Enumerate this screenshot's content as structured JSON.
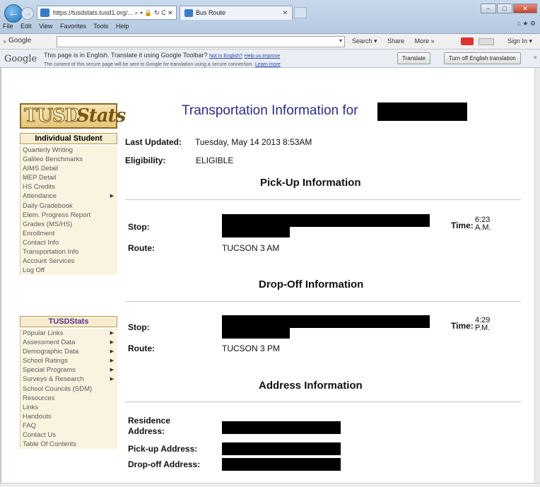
{
  "browser": {
    "address": "https://tusdstats.tusd1.org/...",
    "address_controls": "⌕ ▾ 🔒 ↻ C ✕",
    "tab_title": "Bus Route",
    "menu": [
      "File",
      "Edit",
      "View",
      "Favorites",
      "Tools",
      "Help"
    ],
    "google_label": "Google",
    "google_items": [
      "Search ▾",
      "Share",
      "More »"
    ],
    "signin": "Sign In ▾"
  },
  "translate": {
    "logo": "Google",
    "message": "This page is in English.  Translate it using Google Toolbar?",
    "not_english": "Not in English?",
    "help": "Help us improve",
    "subtext": "The content of this secure page will be sent to Google for translation using a secure connection.",
    "learn_more": "Learn more",
    "translate_button": "Translate",
    "turn_off_button": "Turn off English translation"
  },
  "logo": {
    "part1": "TUSD",
    "part2": "Stats"
  },
  "sidebar": {
    "section1_title": "Individual Student",
    "section1_items": [
      {
        "label": "Quarterly Writing",
        "arrow": false
      },
      {
        "label": "Galileo Benchmarks",
        "arrow": false
      },
      {
        "label": "AIMS Detail",
        "arrow": false
      },
      {
        "label": "MEP Detail",
        "arrow": false
      },
      {
        "label": "HS Credits",
        "arrow": false
      },
      {
        "label": "Attendance",
        "arrow": true
      },
      {
        "label": "Daily Gradebook",
        "arrow": false
      },
      {
        "label": "Elem. Progress Report",
        "arrow": false
      },
      {
        "label": "Grades (MS/HS)",
        "arrow": false
      },
      {
        "label": "Enrollment",
        "arrow": false
      },
      {
        "label": "Contact Info",
        "arrow": false
      },
      {
        "label": "Transportation Info",
        "arrow": false
      },
      {
        "label": "Account Services",
        "arrow": false
      },
      {
        "label": "Log Off",
        "arrow": false
      }
    ],
    "section2_title": "TUSDStats",
    "section2_items": [
      {
        "label": "Popular Links",
        "arrow": true
      },
      {
        "label": "Assessment Data",
        "arrow": true
      },
      {
        "label": "Demographic Data",
        "arrow": true
      },
      {
        "label": "School Ratings",
        "arrow": true
      },
      {
        "label": "Special Programs",
        "arrow": true
      },
      {
        "label": "Surveys & Research",
        "arrow": true
      },
      {
        "label": "School Councils (SDM)",
        "arrow": false
      },
      {
        "label": "Resources",
        "arrow": false
      },
      {
        "label": "Links",
        "arrow": false
      },
      {
        "label": "Handouts",
        "arrow": false
      },
      {
        "label": "FAQ",
        "arrow": false
      },
      {
        "label": "Contact Us",
        "arrow": false
      },
      {
        "label": "Table Of Contents",
        "arrow": false
      }
    ]
  },
  "main": {
    "title": "Transportation Information for",
    "last_updated_label": "Last Updated:",
    "last_updated_value": "Tuesday, May 14 2013 8:53AM",
    "eligibility_label": "Eligibility:",
    "eligibility_value": "ELIGIBLE",
    "pickup": {
      "heading": "Pick-Up Information",
      "stop_label": "Stop:",
      "time_label": "Time:",
      "time_value": "6:23 A.M.",
      "route_label": "Route:",
      "route_value": "TUCSON 3 AM"
    },
    "dropoff": {
      "heading": "Drop-Off Information",
      "stop_label": "Stop:",
      "time_label": "Time:",
      "time_value": "4:29 P.M.",
      "route_label": "Route:",
      "route_value": "TUCSON 3 PM"
    },
    "address": {
      "heading": "Address Information",
      "residence_label": "Residence Address:",
      "pickup_label": "Pick-up Address:",
      "dropoff_label": "Drop-off Address:"
    }
  }
}
